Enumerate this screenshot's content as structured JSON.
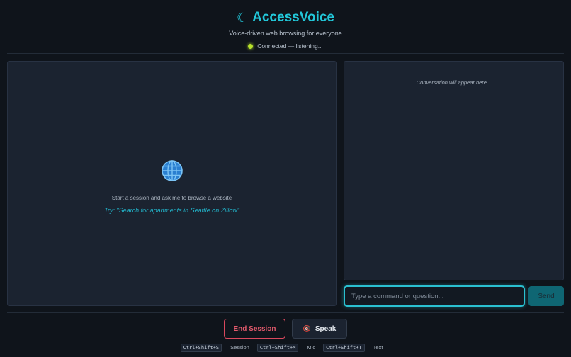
{
  "app": {
    "moon_icon": "crescent-moon-icon",
    "title": "AccessVoice",
    "subtitle": "Voice-driven web browsing for everyone",
    "status_text": "Connected — listening...",
    "status_color": "#b7e12b",
    "accent_color": "#22c7d9"
  },
  "browser": {
    "icon": "globe-icon",
    "hint": "Start a session and ask me to browse a website",
    "example": "Try: \"Search for apartments in Seattle on Zillow\""
  },
  "chat": {
    "placeholder": "Conversation will appear here...",
    "input_placeholder": "Type a command or question...",
    "send_label": "Send"
  },
  "controls": {
    "end_session_label": "End Session",
    "end_session_color": "#d9485d",
    "speak_icon": "muted-speaker-icon",
    "speak_label": "Speak"
  },
  "shortcuts": [
    {
      "keys": "Ctrl+Shift+S",
      "label": "Session"
    },
    {
      "keys": "Ctrl+Shift+M",
      "label": "Mic"
    },
    {
      "keys": "Ctrl+Shift+T",
      "label": "Text"
    }
  ]
}
